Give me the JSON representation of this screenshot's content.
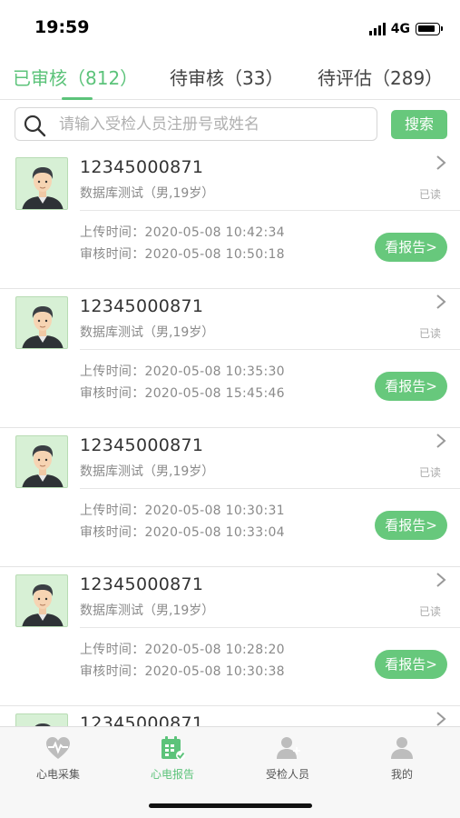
{
  "status_bar": {
    "time": "19:59",
    "network": "4G"
  },
  "tabs": [
    {
      "label": "已审核（812）",
      "active": true
    },
    {
      "label": "待审核（33）",
      "active": false
    },
    {
      "label": "待评估（289）",
      "active": false
    }
  ],
  "search": {
    "placeholder": "请输入受检人员注册号或姓名",
    "button_label": "搜索",
    "icon": "search-icon"
  },
  "records": [
    {
      "id": "12345000871",
      "info": "数据库测试（男,19岁）",
      "status": "已读",
      "upload_label": "上传时间：",
      "upload_time": "2020-05-08 10:42:34",
      "review_label": "审核时间：",
      "review_time": "2020-05-08 10:50:18",
      "action": "看报告>"
    },
    {
      "id": "12345000871",
      "info": "数据库测试（男,19岁）",
      "status": "已读",
      "upload_label": "上传时间：",
      "upload_time": "2020-05-08 10:35:30",
      "review_label": "审核时间：",
      "review_time": "2020-05-08 15:45:46",
      "action": "看报告>"
    },
    {
      "id": "12345000871",
      "info": "数据库测试（男,19岁）",
      "status": "已读",
      "upload_label": "上传时间：",
      "upload_time": "2020-05-08 10:30:31",
      "review_label": "审核时间：",
      "review_time": "2020-05-08 10:33:04",
      "action": "看报告>"
    },
    {
      "id": "12345000871",
      "info": "数据库测试（男,19岁）",
      "status": "已读",
      "upload_label": "上传时间：",
      "upload_time": "2020-05-08 10:28:20",
      "review_label": "审核时间：",
      "review_time": "2020-05-08 10:30:38",
      "action": "看报告>"
    },
    {
      "id": "12345000871"
    }
  ],
  "bottom_nav": [
    {
      "label": "心电采集",
      "icon": "heart-pulse-icon",
      "active": false
    },
    {
      "label": "心电报告",
      "icon": "report-calendar-icon",
      "active": true
    },
    {
      "label": "受检人员",
      "icon": "add-person-icon",
      "active": false
    },
    {
      "label": "我的",
      "icon": "person-icon",
      "active": false
    }
  ],
  "colors": {
    "accent": "#5cc37a",
    "button": "#67c87c",
    "avatar_bg": "#d7f0d5",
    "nav_icon_inactive": "#bdbdbd"
  }
}
